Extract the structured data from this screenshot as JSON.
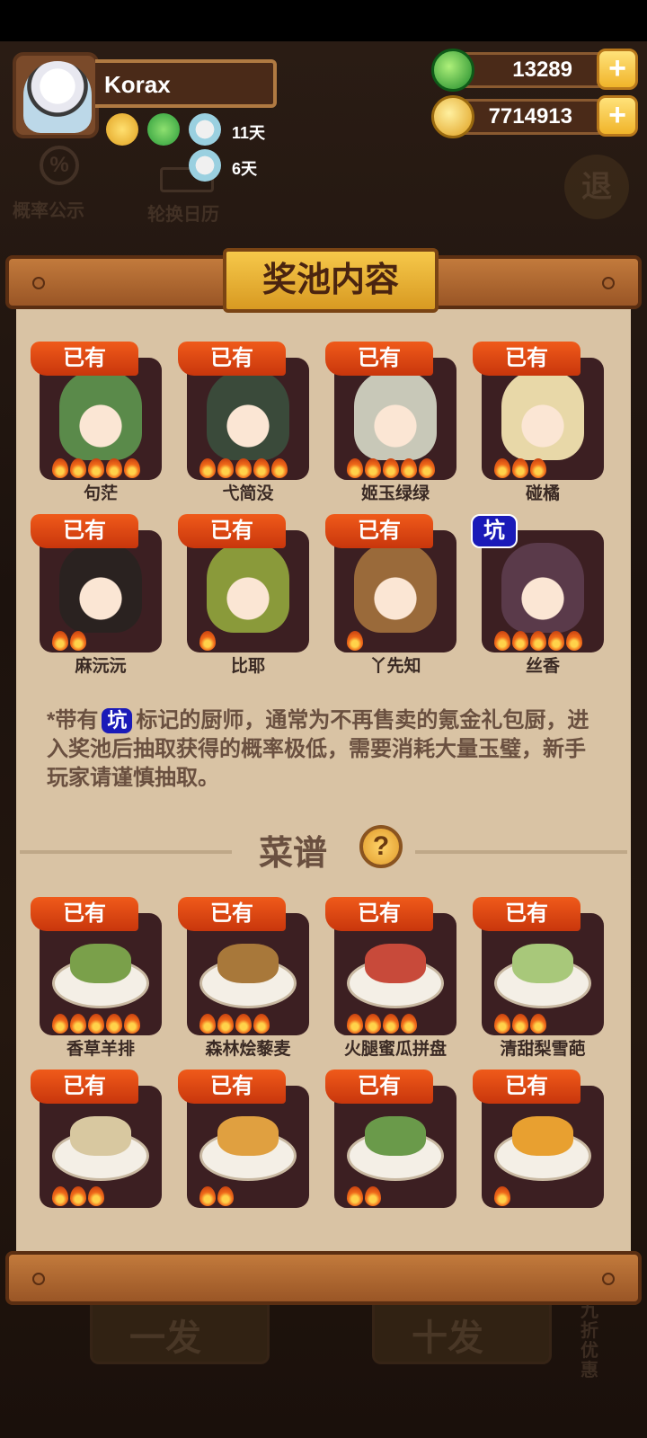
{
  "player": {
    "name": "Korax",
    "buffs": [
      {
        "icon": "gold-boost-icon",
        "days": ""
      },
      {
        "icon": "jade-boost-icon",
        "days": ""
      },
      {
        "icon": "dish-boost-icon",
        "days": "11天"
      },
      {
        "icon": "dish-boost-icon",
        "days": "6天"
      }
    ]
  },
  "currency": {
    "jade": "13289",
    "gold": "7714913"
  },
  "background": {
    "rate_label": "概率公示",
    "calendar_label": "轮换日历",
    "exit_label": "退",
    "single_draw": "一发",
    "ten_draw": "十发",
    "discount": "九折优惠"
  },
  "panel": {
    "title": "奖池内容",
    "chefs": [
      {
        "name": "句茫",
        "badge": "已有",
        "stars": 5
      },
      {
        "name": "弋简没",
        "badge": "已有",
        "stars": 5
      },
      {
        "name": "姬玉绿绿",
        "badge": "已有",
        "stars": 5
      },
      {
        "name": "碰橘",
        "badge": "已有",
        "stars": 3
      },
      {
        "name": "麻沅沅",
        "badge": "已有",
        "stars": 2
      },
      {
        "name": "比耶",
        "badge": "已有",
        "stars": 1
      },
      {
        "name": "丫先知",
        "badge": "已有",
        "stars": 1
      },
      {
        "name": "丝香",
        "badge": "坑",
        "stars": 5
      }
    ],
    "note_prefix": "*带有",
    "note_tag": "坑",
    "note_text": "标记的厨师，通常为不再售卖的氪金礼包厨，进入奖池后抽取获得的概率极低，需要消耗大量玉璧，新手玩家请谨慎抽取。",
    "recipe_title": "菜谱",
    "recipe_help": "?",
    "recipes": [
      {
        "name": "香草羊排",
        "badge": "已有",
        "stars": 5
      },
      {
        "name": "森林烩藜麦",
        "badge": "已有",
        "stars": 4
      },
      {
        "name": "火腿蜜瓜拼盘",
        "badge": "已有",
        "stars": 4
      },
      {
        "name": "清甜梨雪葩",
        "badge": "已有",
        "stars": 3
      },
      {
        "name": "",
        "badge": "已有",
        "stars": 3
      },
      {
        "name": "",
        "badge": "已有",
        "stars": 2
      },
      {
        "name": "",
        "badge": "已有",
        "stars": 2
      },
      {
        "name": "",
        "badge": "已有",
        "stars": 1
      }
    ]
  },
  "colors": {
    "badge_owned": "#e04a14",
    "badge_pit": "#1a1ab8",
    "panel_bg": "#d9c3a4",
    "card_bg": "#3c1f22"
  }
}
